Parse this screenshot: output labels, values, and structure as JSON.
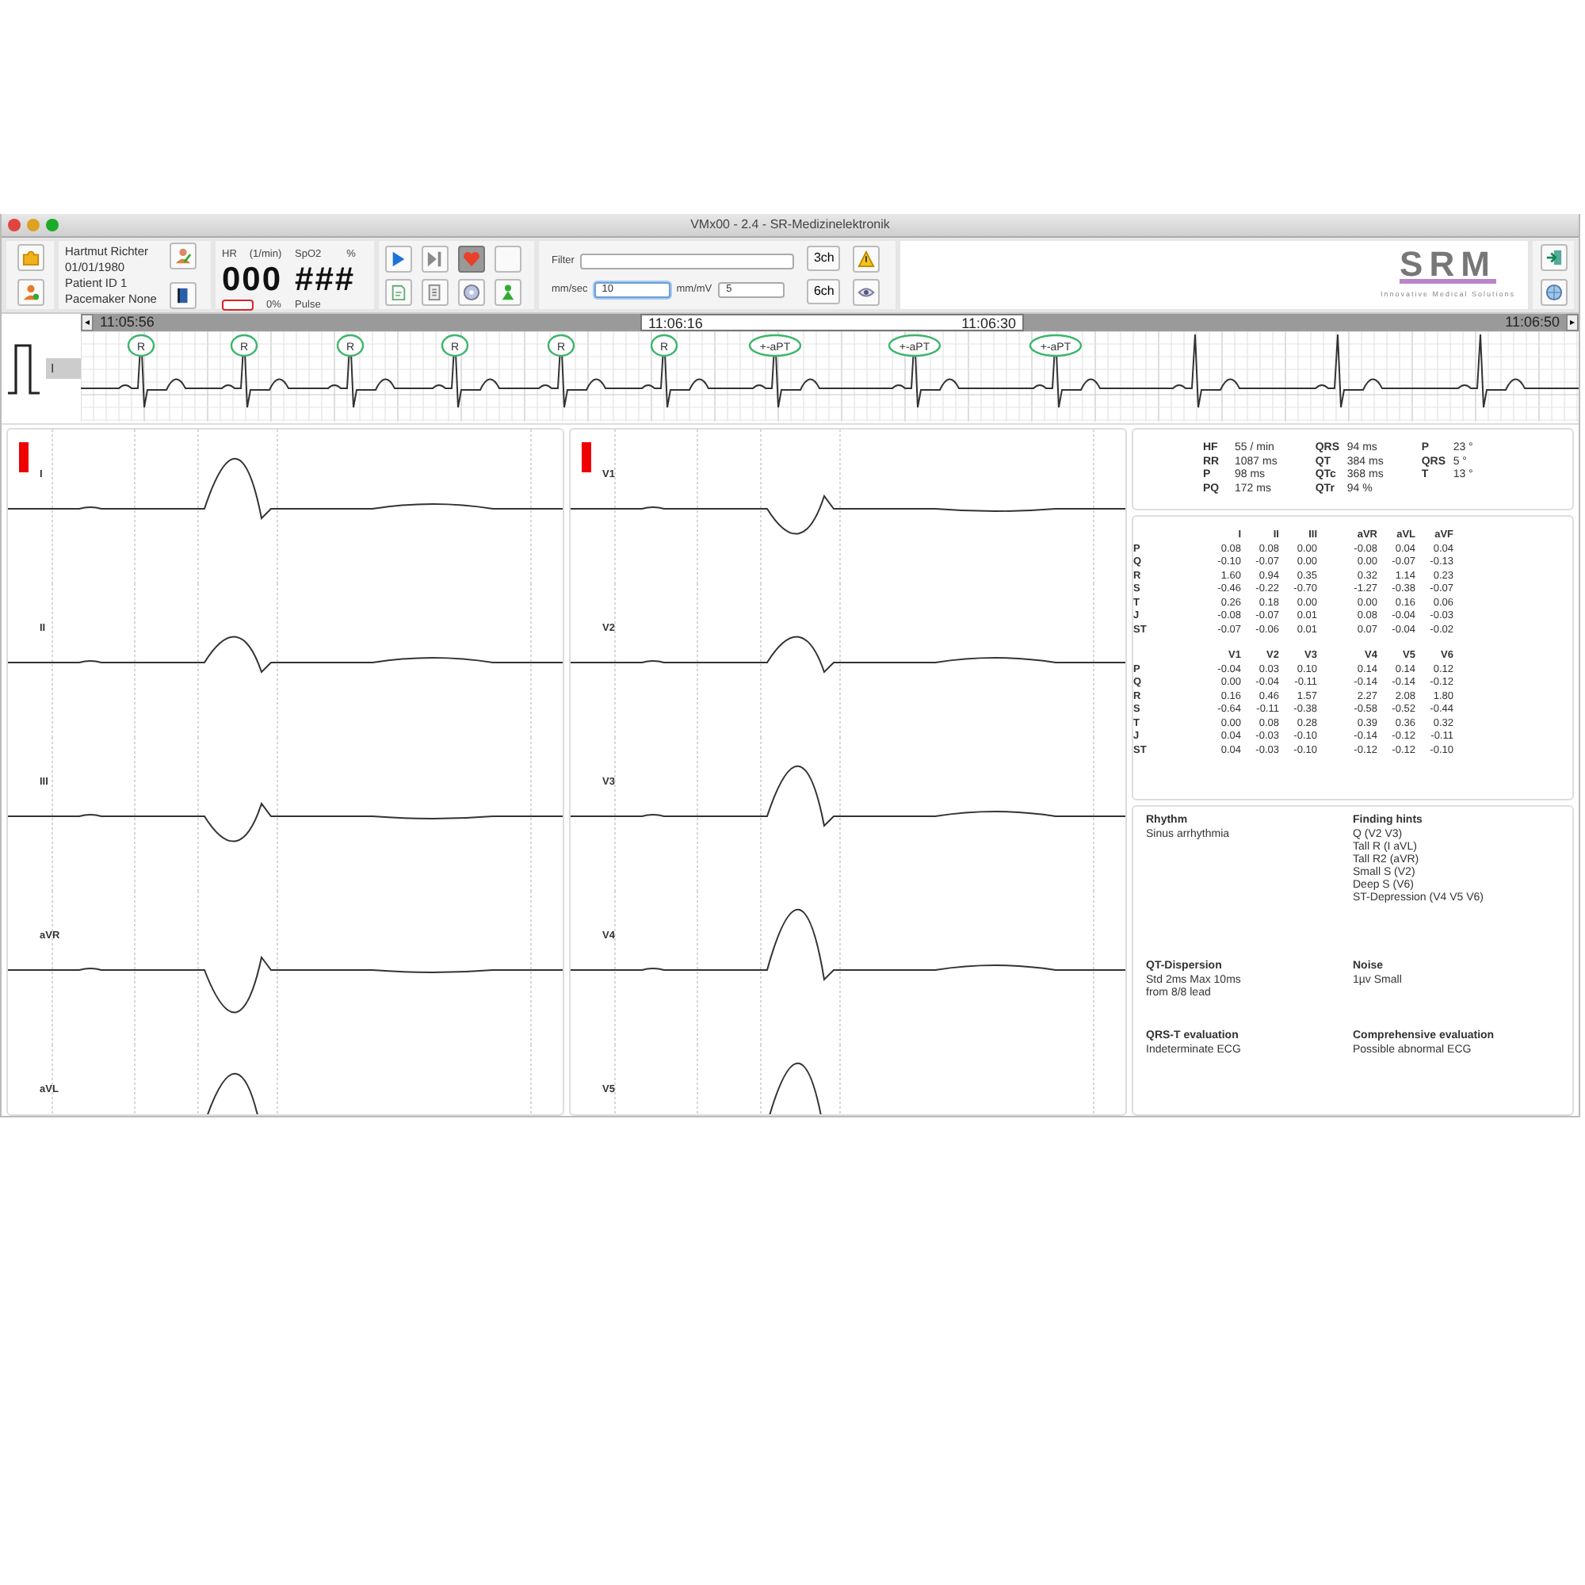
{
  "window": {
    "title": "VMx00 - 2.4 - SR-Medizinelektronik"
  },
  "patient": {
    "name": "Hartmut Richter",
    "birth_date": "01/01/1980",
    "patient_id": "Patient ID 1",
    "pacemaker": "Pacemaker None"
  },
  "vitals": {
    "hr_label": "HR",
    "hr_unit": "(1/min)",
    "hr_value": "000",
    "battery_reading": "0%",
    "spo2_label": "SpO2",
    "spo2_unit": "%",
    "spo2_value": "###",
    "pulse_label": "Pulse"
  },
  "controls": [
    {
      "kind": "play",
      "selected": false
    },
    {
      "kind": "step",
      "selected": false
    },
    {
      "kind": "heart",
      "selected": true
    },
    {
      "kind": "blank",
      "selected": false
    },
    {
      "kind": "page",
      "selected": false
    },
    {
      "kind": "document",
      "selected": false
    },
    {
      "kind": "disc",
      "selected": false
    },
    {
      "kind": "figure",
      "selected": false
    }
  ],
  "filter": {
    "label": "Filter"
  },
  "speed": {
    "label": "mm/sec",
    "value": "10"
  },
  "gain": {
    "label": "mm/mV",
    "value": "5"
  },
  "channel_buttons": [
    "3ch",
    "6ch"
  ],
  "logo": {
    "text": "SRM",
    "tagline": "Innovative Medical Solutions"
  },
  "rhythm": {
    "lead": "I",
    "scroll_left": "◂",
    "scroll_right": "▸",
    "times": [
      "11:05:56",
      "11:06:16",
      "11:06:30",
      "11:06:50"
    ],
    "annotations": [
      "R",
      "R",
      "R",
      "R",
      "R",
      "R",
      "+-aPT",
      "+-aPT",
      "+-aPT"
    ]
  },
  "leads": [
    [
      {
        "name": "I",
        "kind": "positive"
      },
      {
        "name": "II",
        "kind": "small"
      },
      {
        "name": "III",
        "kind": "small-negative"
      },
      {
        "name": "aVR",
        "kind": "negative"
      },
      {
        "name": "aVL",
        "kind": "positive"
      }
    ],
    [
      {
        "name": "V1",
        "kind": "small-negative"
      },
      {
        "name": "V2",
        "kind": "small"
      },
      {
        "name": "V3",
        "kind": "positive"
      },
      {
        "name": "V4",
        "kind": "tall"
      },
      {
        "name": "V5",
        "kind": "tall"
      }
    ]
  ],
  "measurements": [
    [
      {
        "label": "HF",
        "value": "55 / min"
      },
      {
        "label": "RR",
        "value": "1087 ms"
      },
      {
        "label": "P",
        "value": "98 ms"
      },
      {
        "label": "PQ",
        "value": "172 ms"
      }
    ],
    [
      {
        "label": "QRS",
        "value": "94 ms"
      },
      {
        "label": "QT",
        "value": "384 ms"
      },
      {
        "label": "QTc",
        "value": "368 ms"
      },
      {
        "label": "QTr",
        "value": "94 %"
      }
    ],
    [
      {
        "label": "P",
        "value": "23 °"
      },
      {
        "label": "QRS",
        "value": "5 °"
      },
      {
        "label": "T",
        "value": "13 °"
      }
    ]
  ],
  "amplitudes": [
    {
      "columns": [
        "I",
        "II",
        "III",
        "aVR",
        "aVL",
        "aVF"
      ],
      "rows": [
        {
          "wave": "P",
          "values": [
            "0.08",
            "0.08",
            "0.00",
            "-0.08",
            "0.04",
            "0.04"
          ]
        },
        {
          "wave": "Q",
          "values": [
            "-0.10",
            "-0.07",
            "0.00",
            "0.00",
            "-0.07",
            "-0.13"
          ]
        },
        {
          "wave": "R",
          "values": [
            "1.60",
            "0.94",
            "0.35",
            "0.32",
            "1.14",
            "0.23"
          ]
        },
        {
          "wave": "S",
          "values": [
            "-0.46",
            "-0.22",
            "-0.70",
            "-1.27",
            "-0.38",
            "-0.07"
          ]
        },
        {
          "wave": "T",
          "values": [
            "0.26",
            "0.18",
            "0.00",
            "0.00",
            "0.16",
            "0.06"
          ]
        },
        {
          "wave": "J",
          "values": [
            "-0.08",
            "-0.07",
            "0.01",
            "0.08",
            "-0.04",
            "-0.03"
          ]
        },
        {
          "wave": "ST",
          "values": [
            "-0.07",
            "-0.06",
            "0.01",
            "0.07",
            "-0.04",
            "-0.02"
          ]
        }
      ]
    },
    {
      "columns": [
        "V1",
        "V2",
        "V3",
        "V4",
        "V5",
        "V6"
      ],
      "rows": [
        {
          "wave": "P",
          "values": [
            "-0.04",
            "0.03",
            "0.10",
            "0.14",
            "0.14",
            "0.12"
          ]
        },
        {
          "wave": "Q",
          "values": [
            "0.00",
            "-0.04",
            "-0.11",
            "-0.14",
            "-0.14",
            "-0.12"
          ]
        },
        {
          "wave": "R",
          "values": [
            "0.16",
            "0.46",
            "1.57",
            "2.27",
            "2.08",
            "1.80"
          ]
        },
        {
          "wave": "S",
          "values": [
            "-0.64",
            "-0.11",
            "-0.38",
            "-0.58",
            "-0.52",
            "-0.44"
          ]
        },
        {
          "wave": "T",
          "values": [
            "0.00",
            "0.08",
            "0.28",
            "0.39",
            "0.36",
            "0.32"
          ]
        },
        {
          "wave": "J",
          "values": [
            "0.04",
            "-0.03",
            "-0.10",
            "-0.14",
            "-0.12",
            "-0.11"
          ]
        },
        {
          "wave": "ST",
          "values": [
            "0.04",
            "-0.03",
            "-0.10",
            "-0.12",
            "-0.12",
            "-0.10"
          ]
        }
      ]
    }
  ],
  "findings": [
    {
      "title": "Rhythm",
      "lines": [
        "Sinus arrhythmia"
      ]
    },
    {
      "title": "Finding hints",
      "lines": [
        "Q (V2 V3)",
        "Tall R (I aVL)",
        "Tall R2 (aVR)",
        "Small S (V2)",
        "Deep S (V6)",
        "ST-Depression (V4 V5 V6)"
      ]
    },
    {
      "title": "QT-Dispersion",
      "lines": [
        "Std 2ms Max 10ms",
        "from 8/8 lead"
      ]
    },
    {
      "title": "Noise",
      "lines": [
        "1µv Small"
      ]
    },
    {
      "title": "QRS-T evaluation",
      "lines": [
        "Indeterminate ECG"
      ]
    },
    {
      "title": "Comprehensive evaluation",
      "lines": [
        "Possible abnormal ECG"
      ]
    }
  ]
}
